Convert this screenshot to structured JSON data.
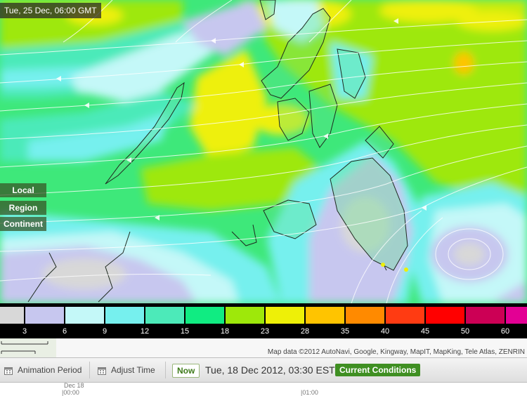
{
  "map": {
    "timestamp": "Tue, 25 Dec, 06:00 GMT",
    "zoom_buttons": [
      "Local",
      "Region",
      "Continent"
    ]
  },
  "legend": {
    "labels": [
      "3",
      "6",
      "9",
      "12",
      "15",
      "18",
      "23",
      "28",
      "35",
      "40",
      "45",
      "50",
      "60"
    ],
    "colors": [
      "#d8d8d8",
      "#c7c7ef",
      "#c4f8f8",
      "#76f0ee",
      "#4ceab9",
      "#10ec82",
      "#9ee80a",
      "#eef007",
      "#ffc400",
      "#ff8a00",
      "#ff3b12",
      "#ff0000",
      "#cc0055",
      "#e30094"
    ]
  },
  "attribution": "Map data ©2012 AutoNavi, Google, Kingway, MapIT, MapKing, Tele Atlas, ZENRIN",
  "toolbar": {
    "animation_period": "Animation Period",
    "adjust_time": "Adjust Time",
    "now": "Now",
    "datetime": "Tue, 18 Dec 2012, 03:30 EST",
    "current_conditions": "Current Conditions"
  },
  "timeline": {
    "date": "Dec 18",
    "start": "|00:00",
    "next": "|01:00"
  }
}
